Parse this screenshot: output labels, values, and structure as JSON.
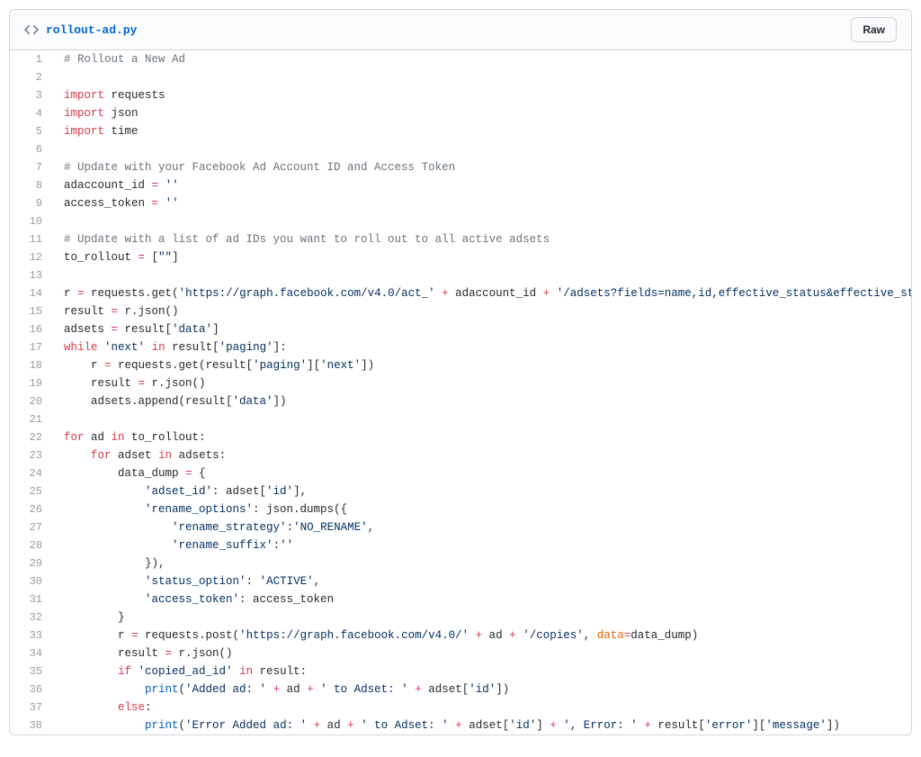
{
  "header": {
    "filename": "rollout-ad.py",
    "raw_label": "Raw"
  },
  "code": {
    "lines": [
      {
        "n": 1,
        "tokens": [
          {
            "cls": "c",
            "t": "# Rollout a New Ad"
          }
        ]
      },
      {
        "n": 2,
        "tokens": []
      },
      {
        "n": 3,
        "tokens": [
          {
            "cls": "k",
            "t": "import"
          },
          {
            "cls": "p",
            "t": " requests"
          }
        ]
      },
      {
        "n": 4,
        "tokens": [
          {
            "cls": "k",
            "t": "import"
          },
          {
            "cls": "p",
            "t": " json"
          }
        ]
      },
      {
        "n": 5,
        "tokens": [
          {
            "cls": "k",
            "t": "import"
          },
          {
            "cls": "p",
            "t": " time"
          }
        ]
      },
      {
        "n": 6,
        "tokens": []
      },
      {
        "n": 7,
        "tokens": [
          {
            "cls": "c",
            "t": "# Update with your Facebook Ad Account ID and Access Token"
          }
        ]
      },
      {
        "n": 8,
        "tokens": [
          {
            "cls": "p",
            "t": "adaccount_id "
          },
          {
            "cls": "k",
            "t": "="
          },
          {
            "cls": "p",
            "t": " "
          },
          {
            "cls": "s",
            "t": "''"
          }
        ]
      },
      {
        "n": 9,
        "tokens": [
          {
            "cls": "p",
            "t": "access_token "
          },
          {
            "cls": "k",
            "t": "="
          },
          {
            "cls": "p",
            "t": " "
          },
          {
            "cls": "s",
            "t": "''"
          }
        ]
      },
      {
        "n": 10,
        "tokens": []
      },
      {
        "n": 11,
        "tokens": [
          {
            "cls": "c",
            "t": "# Update with a list of ad IDs you want to roll out to all active adsets"
          }
        ]
      },
      {
        "n": 12,
        "tokens": [
          {
            "cls": "p",
            "t": "to_rollout "
          },
          {
            "cls": "k",
            "t": "="
          },
          {
            "cls": "p",
            "t": " ["
          },
          {
            "cls": "s",
            "t": "\"\""
          },
          {
            "cls": "p",
            "t": "]"
          }
        ]
      },
      {
        "n": 13,
        "tokens": []
      },
      {
        "n": 14,
        "tokens": [
          {
            "cls": "p",
            "t": "r "
          },
          {
            "cls": "k",
            "t": "="
          },
          {
            "cls": "p",
            "t": " requests.get("
          },
          {
            "cls": "s",
            "t": "'https://graph.facebook.com/v4.0/act_'"
          },
          {
            "cls": "p",
            "t": " "
          },
          {
            "cls": "k",
            "t": "+"
          },
          {
            "cls": "p",
            "t": " adaccount_id "
          },
          {
            "cls": "k",
            "t": "+"
          },
          {
            "cls": "p",
            "t": " "
          },
          {
            "cls": "s",
            "t": "'/adsets?fields=name,id,effective_status&effective_sta"
          }
        ]
      },
      {
        "n": 15,
        "tokens": [
          {
            "cls": "p",
            "t": "result "
          },
          {
            "cls": "k",
            "t": "="
          },
          {
            "cls": "p",
            "t": " r.json()"
          }
        ]
      },
      {
        "n": 16,
        "tokens": [
          {
            "cls": "p",
            "t": "adsets "
          },
          {
            "cls": "k",
            "t": "="
          },
          {
            "cls": "p",
            "t": " result["
          },
          {
            "cls": "s",
            "t": "'data'"
          },
          {
            "cls": "p",
            "t": "]"
          }
        ]
      },
      {
        "n": 17,
        "tokens": [
          {
            "cls": "k",
            "t": "while"
          },
          {
            "cls": "p",
            "t": " "
          },
          {
            "cls": "s",
            "t": "'next'"
          },
          {
            "cls": "p",
            "t": " "
          },
          {
            "cls": "k",
            "t": "in"
          },
          {
            "cls": "p",
            "t": " result["
          },
          {
            "cls": "s",
            "t": "'paging'"
          },
          {
            "cls": "p",
            "t": "]:"
          }
        ]
      },
      {
        "n": 18,
        "tokens": [
          {
            "cls": "p",
            "t": "    r "
          },
          {
            "cls": "k",
            "t": "="
          },
          {
            "cls": "p",
            "t": " requests.get(result["
          },
          {
            "cls": "s",
            "t": "'paging'"
          },
          {
            "cls": "p",
            "t": "]["
          },
          {
            "cls": "s",
            "t": "'next'"
          },
          {
            "cls": "p",
            "t": "])"
          }
        ]
      },
      {
        "n": 19,
        "tokens": [
          {
            "cls": "p",
            "t": "    result "
          },
          {
            "cls": "k",
            "t": "="
          },
          {
            "cls": "p",
            "t": " r.json()"
          }
        ]
      },
      {
        "n": 20,
        "tokens": [
          {
            "cls": "p",
            "t": "    adsets.append(result["
          },
          {
            "cls": "s",
            "t": "'data'"
          },
          {
            "cls": "p",
            "t": "])"
          }
        ]
      },
      {
        "n": 21,
        "tokens": []
      },
      {
        "n": 22,
        "tokens": [
          {
            "cls": "k",
            "t": "for"
          },
          {
            "cls": "p",
            "t": " ad "
          },
          {
            "cls": "k",
            "t": "in"
          },
          {
            "cls": "p",
            "t": " to_rollout:"
          }
        ]
      },
      {
        "n": 23,
        "tokens": [
          {
            "cls": "p",
            "t": "    "
          },
          {
            "cls": "k",
            "t": "for"
          },
          {
            "cls": "p",
            "t": " adset "
          },
          {
            "cls": "k",
            "t": "in"
          },
          {
            "cls": "p",
            "t": " adsets:"
          }
        ]
      },
      {
        "n": 24,
        "tokens": [
          {
            "cls": "p",
            "t": "        data_dump "
          },
          {
            "cls": "k",
            "t": "="
          },
          {
            "cls": "p",
            "t": " {"
          }
        ]
      },
      {
        "n": 25,
        "tokens": [
          {
            "cls": "p",
            "t": "            "
          },
          {
            "cls": "s",
            "t": "'adset_id'"
          },
          {
            "cls": "p",
            "t": ": adset["
          },
          {
            "cls": "s",
            "t": "'id'"
          },
          {
            "cls": "p",
            "t": "],"
          }
        ]
      },
      {
        "n": 26,
        "tokens": [
          {
            "cls": "p",
            "t": "            "
          },
          {
            "cls": "s",
            "t": "'rename_options'"
          },
          {
            "cls": "p",
            "t": ": json.dumps({"
          }
        ]
      },
      {
        "n": 27,
        "tokens": [
          {
            "cls": "p",
            "t": "                "
          },
          {
            "cls": "s",
            "t": "'rename_strategy'"
          },
          {
            "cls": "p",
            "t": ":"
          },
          {
            "cls": "s",
            "t": "'NO_RENAME'"
          },
          {
            "cls": "p",
            "t": ","
          }
        ]
      },
      {
        "n": 28,
        "tokens": [
          {
            "cls": "p",
            "t": "                "
          },
          {
            "cls": "s",
            "t": "'rename_suffix'"
          },
          {
            "cls": "p",
            "t": ":"
          },
          {
            "cls": "s",
            "t": "''"
          }
        ]
      },
      {
        "n": 29,
        "tokens": [
          {
            "cls": "p",
            "t": "            }),"
          }
        ]
      },
      {
        "n": 30,
        "tokens": [
          {
            "cls": "p",
            "t": "            "
          },
          {
            "cls": "s",
            "t": "'status_option'"
          },
          {
            "cls": "p",
            "t": ": "
          },
          {
            "cls": "s",
            "t": "'ACTIVE'"
          },
          {
            "cls": "p",
            "t": ","
          }
        ]
      },
      {
        "n": 31,
        "tokens": [
          {
            "cls": "p",
            "t": "            "
          },
          {
            "cls": "s",
            "t": "'access_token'"
          },
          {
            "cls": "p",
            "t": ": access_token"
          }
        ]
      },
      {
        "n": 32,
        "tokens": [
          {
            "cls": "p",
            "t": "        }"
          }
        ]
      },
      {
        "n": 33,
        "tokens": [
          {
            "cls": "p",
            "t": "        r "
          },
          {
            "cls": "k",
            "t": "="
          },
          {
            "cls": "p",
            "t": " requests.post("
          },
          {
            "cls": "s",
            "t": "'https://graph.facebook.com/v4.0/'"
          },
          {
            "cls": "p",
            "t": " "
          },
          {
            "cls": "k",
            "t": "+"
          },
          {
            "cls": "p",
            "t": " ad "
          },
          {
            "cls": "k",
            "t": "+"
          },
          {
            "cls": "p",
            "t": " "
          },
          {
            "cls": "s",
            "t": "'/copies'"
          },
          {
            "cls": "p",
            "t": ", "
          },
          {
            "cls": "v",
            "t": "data"
          },
          {
            "cls": "k",
            "t": "="
          },
          {
            "cls": "p",
            "t": "data_dump)"
          }
        ]
      },
      {
        "n": 34,
        "tokens": [
          {
            "cls": "p",
            "t": "        result "
          },
          {
            "cls": "k",
            "t": "="
          },
          {
            "cls": "p",
            "t": " r.json()"
          }
        ]
      },
      {
        "n": 35,
        "tokens": [
          {
            "cls": "p",
            "t": "        "
          },
          {
            "cls": "k",
            "t": "if"
          },
          {
            "cls": "p",
            "t": " "
          },
          {
            "cls": "s",
            "t": "'copied_ad_id'"
          },
          {
            "cls": "p",
            "t": " "
          },
          {
            "cls": "k",
            "t": "in"
          },
          {
            "cls": "p",
            "t": " result:"
          }
        ]
      },
      {
        "n": 36,
        "tokens": [
          {
            "cls": "p",
            "t": "            "
          },
          {
            "cls": "fn",
            "t": "print"
          },
          {
            "cls": "p",
            "t": "("
          },
          {
            "cls": "s",
            "t": "'Added ad: '"
          },
          {
            "cls": "p",
            "t": " "
          },
          {
            "cls": "k",
            "t": "+"
          },
          {
            "cls": "p",
            "t": " ad "
          },
          {
            "cls": "k",
            "t": "+"
          },
          {
            "cls": "p",
            "t": " "
          },
          {
            "cls": "s",
            "t": "' to Adset: '"
          },
          {
            "cls": "p",
            "t": " "
          },
          {
            "cls": "k",
            "t": "+"
          },
          {
            "cls": "p",
            "t": " adset["
          },
          {
            "cls": "s",
            "t": "'id'"
          },
          {
            "cls": "p",
            "t": "])"
          }
        ]
      },
      {
        "n": 37,
        "tokens": [
          {
            "cls": "p",
            "t": "        "
          },
          {
            "cls": "k",
            "t": "else"
          },
          {
            "cls": "p",
            "t": ":"
          }
        ]
      },
      {
        "n": 38,
        "tokens": [
          {
            "cls": "p",
            "t": "            "
          },
          {
            "cls": "fn",
            "t": "print"
          },
          {
            "cls": "p",
            "t": "("
          },
          {
            "cls": "s",
            "t": "'Error Added ad: '"
          },
          {
            "cls": "p",
            "t": " "
          },
          {
            "cls": "k",
            "t": "+"
          },
          {
            "cls": "p",
            "t": " ad "
          },
          {
            "cls": "k",
            "t": "+"
          },
          {
            "cls": "p",
            "t": " "
          },
          {
            "cls": "s",
            "t": "' to Adset: '"
          },
          {
            "cls": "p",
            "t": " "
          },
          {
            "cls": "k",
            "t": "+"
          },
          {
            "cls": "p",
            "t": " adset["
          },
          {
            "cls": "s",
            "t": "'id'"
          },
          {
            "cls": "p",
            "t": "] "
          },
          {
            "cls": "k",
            "t": "+"
          },
          {
            "cls": "p",
            "t": " "
          },
          {
            "cls": "s",
            "t": "', Error: '"
          },
          {
            "cls": "p",
            "t": " "
          },
          {
            "cls": "k",
            "t": "+"
          },
          {
            "cls": "p",
            "t": " result["
          },
          {
            "cls": "s",
            "t": "'error'"
          },
          {
            "cls": "p",
            "t": "]["
          },
          {
            "cls": "s",
            "t": "'message'"
          },
          {
            "cls": "p",
            "t": "])"
          }
        ]
      }
    ]
  }
}
